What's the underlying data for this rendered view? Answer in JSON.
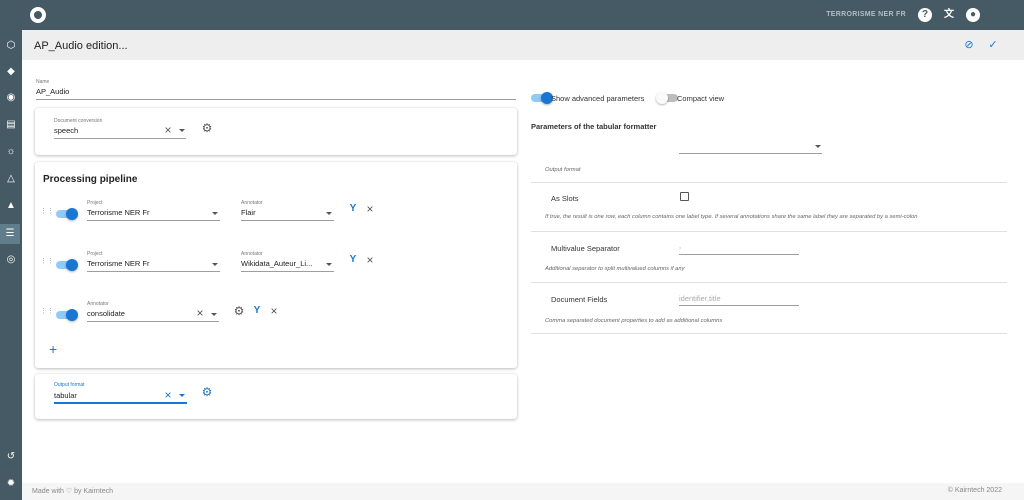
{
  "topbar": {
    "app_title": "TERRORISME NER FR",
    "logo": "eye-logo",
    "icons": {
      "help": "?",
      "translate": "文",
      "account": "●"
    }
  },
  "sidebar": {
    "items": [
      {
        "icon": "cube-icon",
        "glyph": "⬡"
      },
      {
        "icon": "tag-icon",
        "glyph": "◆"
      },
      {
        "icon": "compass-icon",
        "glyph": "◉"
      },
      {
        "icon": "document-icon",
        "glyph": "▤"
      },
      {
        "icon": "bulb-icon",
        "glyph": "☼"
      },
      {
        "icon": "flask-icon",
        "glyph": "△"
      },
      {
        "icon": "bank-icon",
        "glyph": "▲"
      },
      {
        "icon": "list-icon",
        "glyph": "☰"
      },
      {
        "icon": "eye-icon",
        "glyph": "◎"
      }
    ],
    "bottom": [
      {
        "icon": "history-icon",
        "glyph": "↺"
      },
      {
        "icon": "settings-icon",
        "glyph": "✹"
      }
    ]
  },
  "page": {
    "title": "AP_Audio edition...",
    "cancel_icon": "⊘",
    "save_icon": "✓"
  },
  "form": {
    "name_label": "Name",
    "name_value": "AP_Audio",
    "conversion_label": "Document conversion",
    "conversion_value": "speech"
  },
  "pipeline": {
    "title": "Processing pipeline",
    "rows": [
      {
        "project_label": "Project",
        "project_value": "Terrorisme NER Fr",
        "annotator_label": "Annotator",
        "annotator_value": "Flair"
      },
      {
        "project_label": "Project",
        "project_value": "Terrorisme NER Fr",
        "annotator_label": "Annotator",
        "annotator_value": "Wikidata_Auteur_Li..."
      },
      {
        "annotator_label": "Annotator",
        "annotator_value": "consolidate"
      }
    ],
    "add_icon": "+"
  },
  "output": {
    "label": "Output format",
    "value": "tabular"
  },
  "toggles": {
    "advanced": "Show advanced parameters",
    "compact": "Compact view"
  },
  "formatter": {
    "title": "Parameters of the tabular formatter",
    "output_format_hint": "Output format",
    "as_slots_label": "As Slots",
    "as_slots_hint": "If true, the result is one row, each column contains one label type. If several annotations share the same label they are separated by a semi-colon",
    "multivalue_label": "Multivalue Separator",
    "multivalue_value": ",",
    "multivalue_hint": "Additional separator to split multivalued columns if any",
    "fields_label": "Document Fields",
    "fields_placeholder": "identifier,title",
    "fields_hint": "Comma separated document properties to add as additional columns"
  },
  "footer": {
    "left": "Made with ♡ by Kairntech",
    "right": "©   Kairntech 2022"
  },
  "colors": {
    "header": "#455a64",
    "accent": "#1976d2"
  }
}
